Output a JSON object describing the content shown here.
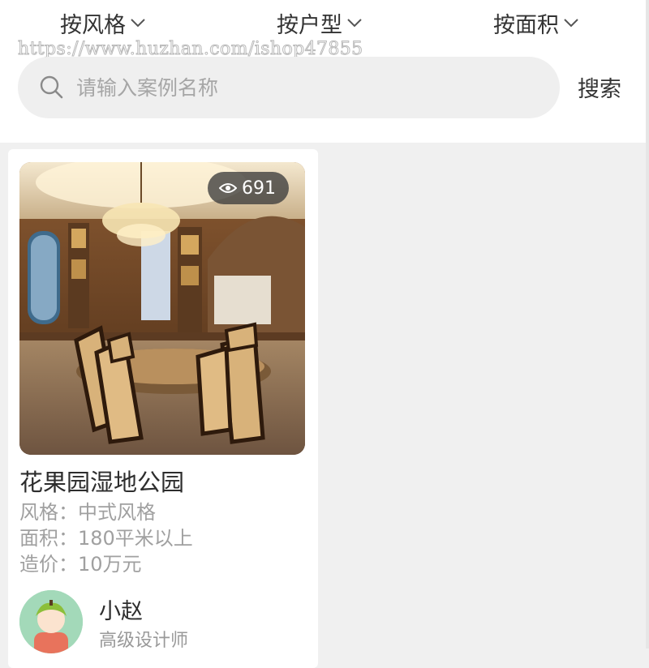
{
  "filters": [
    {
      "label": "按风格"
    },
    {
      "label": "按户型"
    },
    {
      "label": "按面积"
    }
  ],
  "watermark": "https://www.huzhan.com/ishop47855",
  "search": {
    "placeholder": "请输入案例名称",
    "value": "",
    "button_label": "搜索"
  },
  "cases": [
    {
      "views": "691",
      "title": "花果园湿地公园",
      "style": "风格：中式风格",
      "area": "面积：180平米以上",
      "cost": "造价：10万元",
      "designer": {
        "name": "小赵",
        "role": "高级设计师"
      }
    }
  ],
  "colors": {
    "page_bg": "#f0f0f0",
    "search_bg": "#efefef",
    "muted_text": "#a0a0a0",
    "badge_bg": "#3c3c3c"
  },
  "icons": [
    "chevron-down-icon",
    "search-icon",
    "eye-icon",
    "avatar-illustration"
  ]
}
